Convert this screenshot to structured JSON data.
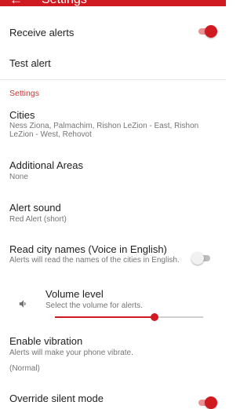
{
  "appbar": {
    "title": "Settings"
  },
  "items": {
    "receive_alerts": {
      "title": "Receive alerts",
      "switch_on": true
    },
    "test_alert": {
      "title": "Test alert"
    },
    "category": "Settings",
    "cities": {
      "title": "Cities",
      "summary": "Ness Ziona, Palmachim, Rishon LeZion - East, Rishon LeZion - West, Rehovot"
    },
    "additional_areas": {
      "title": "Additional Areas",
      "summary": "None"
    },
    "alert_sound": {
      "title": "Alert sound",
      "summary": "Red Alert (short)"
    },
    "read_city_names": {
      "title": "Read city names (Voice in English)",
      "summary": "Alerts will read the names of the cities in English.",
      "switch_on": false
    },
    "volume": {
      "title": "Volume level",
      "summary": "Select the volume for alerts.",
      "level": 0.67
    },
    "vibration": {
      "title": "Enable vibration",
      "summary": "Alerts will make your phone vibrate.",
      "mode": "(Normal)"
    },
    "override_silent": {
      "title": "Override silent mode",
      "switch_on": true
    }
  },
  "colors": {
    "accent": "#d01a22",
    "divider": "#e4e4e4"
  }
}
